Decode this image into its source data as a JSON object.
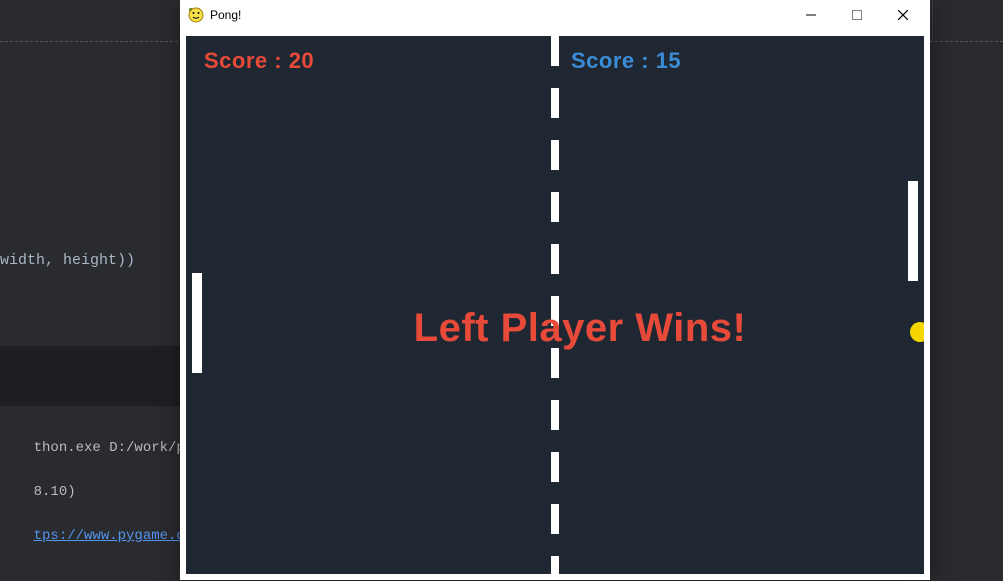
{
  "window": {
    "title": "Pong!"
  },
  "game": {
    "score_label": "Score",
    "left_score": 20,
    "right_score": 15,
    "winner_message": "Left Player Wins!",
    "ball_color": "#f5d600",
    "bg_color": "#1f2732",
    "left_color": "#e84a3a",
    "right_color": "#3a8cd6"
  },
  "ide_background": {
    "code_fragment": "width, height))",
    "console_line1": "thon.exe D:/work/p",
    "console_line2": "8.10)",
    "console_link": "tps://www.pygame.o"
  },
  "computed": {
    "score_left_text": "",
    "score_right_text": ""
  }
}
